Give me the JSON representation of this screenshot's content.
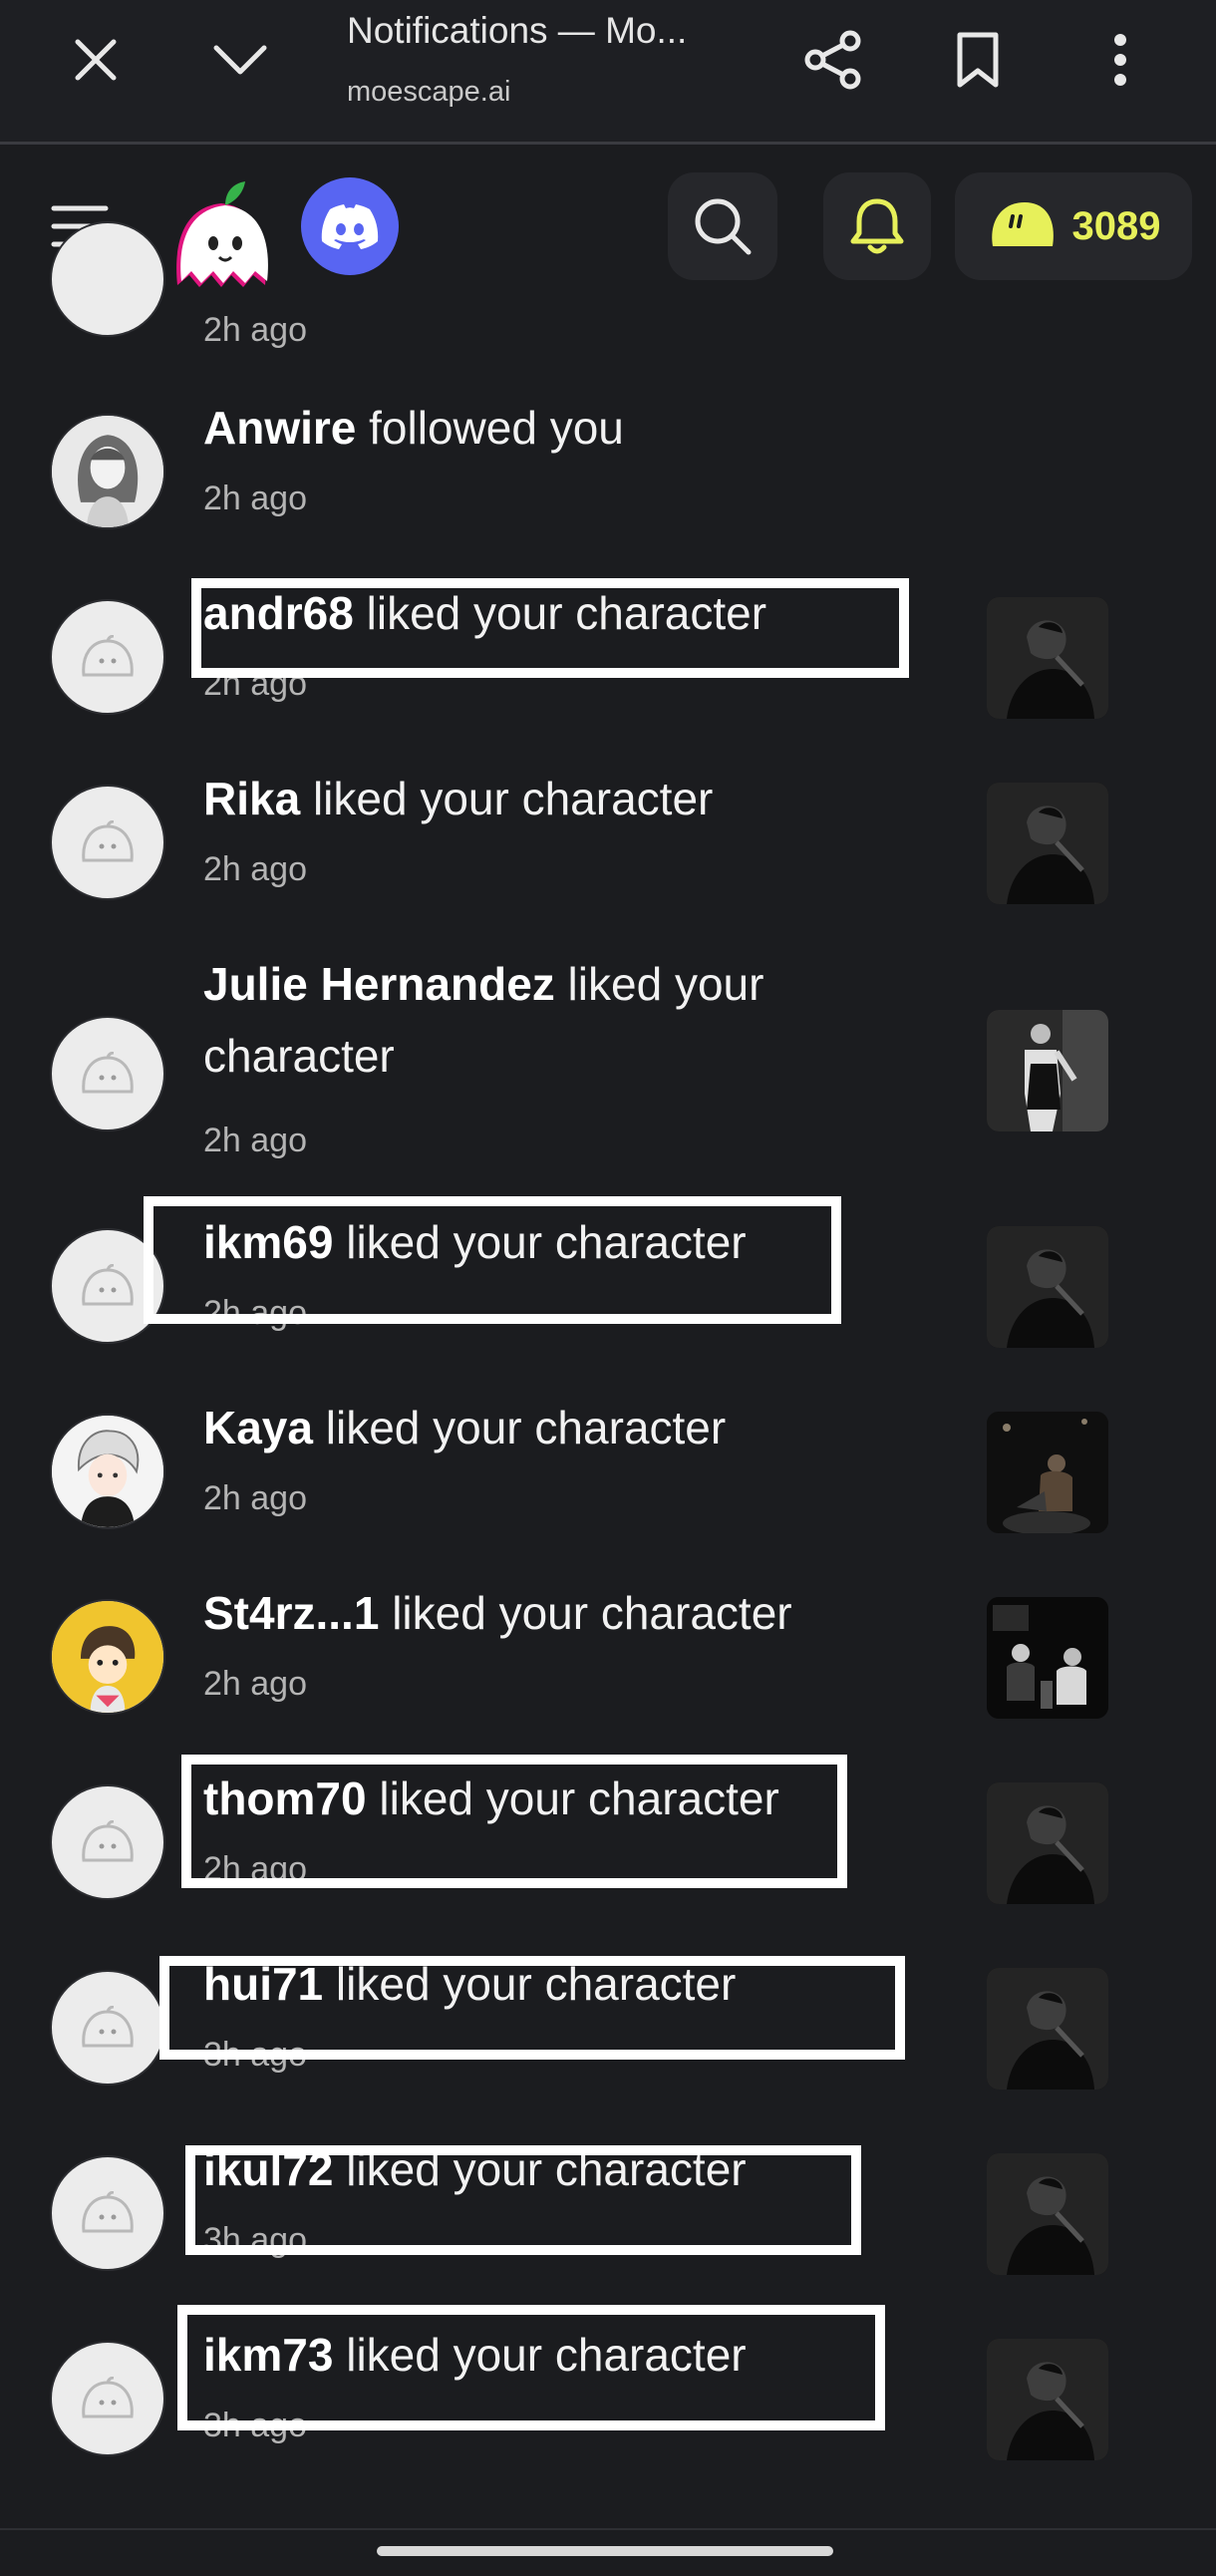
{
  "browser": {
    "title": "Notifications — Mo...",
    "url": "moescape.ai"
  },
  "header": {
    "coins": "3089",
    "accent": "#e7f05a",
    "discord_color": "#5865f2"
  },
  "partial_row": {
    "time": "2h ago"
  },
  "notifications": [
    {
      "user": "Anwire",
      "action": "followed you",
      "time": "2h ago",
      "avatar": "anime-girl",
      "thumb": "none"
    },
    {
      "user": "andr68",
      "action": "liked your character",
      "time": "2h ago",
      "avatar": "default-ghost",
      "thumb": "dark-portrait"
    },
    {
      "user": "Rika",
      "action": "liked your character",
      "time": "2h ago",
      "avatar": "default-ghost",
      "thumb": "dark-portrait"
    },
    {
      "user": "Julie Hernandez",
      "action": "liked your character",
      "time": "2h ago",
      "avatar": "default-ghost",
      "thumb": "standing-figure"
    },
    {
      "user": "ikm69",
      "action": "liked your character",
      "time": "2h ago",
      "avatar": "default-ghost",
      "thumb": "dark-portrait"
    },
    {
      "user": "Kaya ",
      "action": "liked your character",
      "time": "2h ago",
      "avatar": "anime-boy",
      "thumb": "night-scene"
    },
    {
      "user": "St4rz...1",
      "action": "liked your character",
      "time": "2h ago",
      "avatar": "yellow-character",
      "thumb": "group-photo"
    },
    {
      "user": "thom70",
      "action": "liked your character",
      "time": "2h ago",
      "avatar": "default-ghost",
      "thumb": "dark-portrait"
    },
    {
      "user": "hui71",
      "action": "liked your character",
      "time": "3h ago",
      "avatar": "default-ghost",
      "thumb": "dark-portrait"
    },
    {
      "user": "ikul72",
      "action": "liked your character",
      "time": "3h ago",
      "avatar": "default-ghost",
      "thumb": "dark-portrait"
    },
    {
      "user": "ikm73",
      "action": "liked your character",
      "time": "3h ago",
      "avatar": "default-ghost",
      "thumb": "dark-portrait"
    }
  ]
}
